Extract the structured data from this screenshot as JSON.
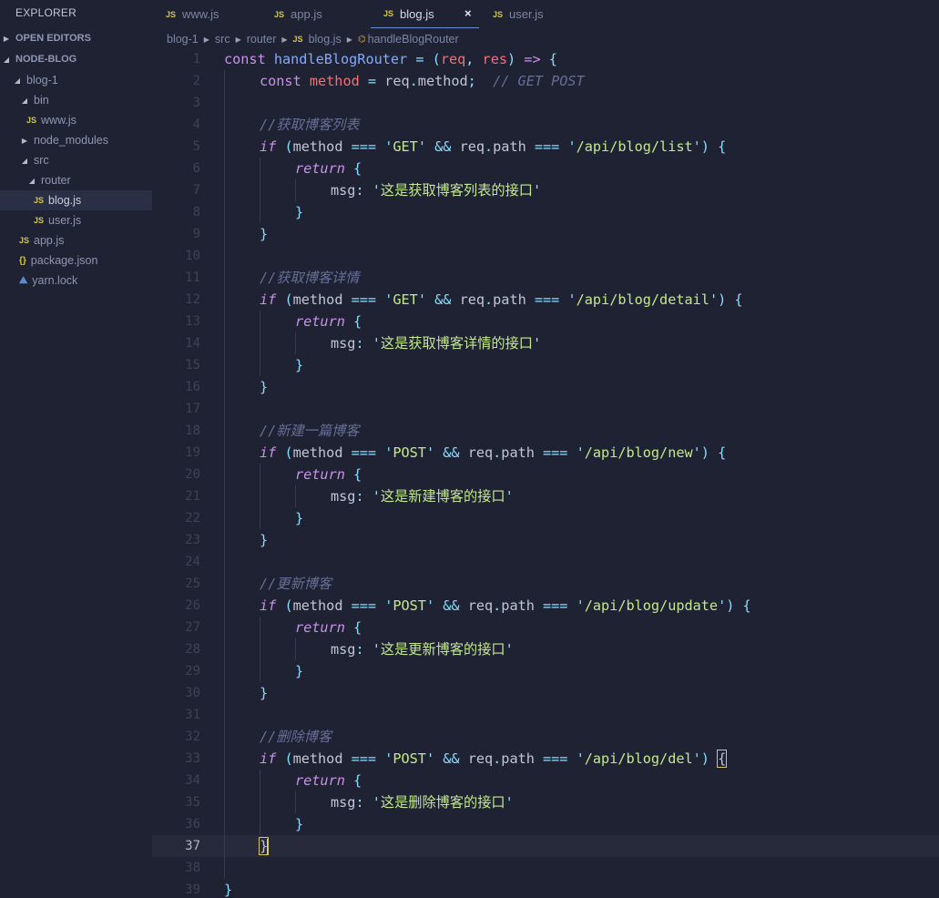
{
  "sidebar": {
    "title": "EXPLORER",
    "sections": [
      {
        "label": "OPEN EDITORS"
      },
      {
        "label": "NODE-BLOG"
      }
    ],
    "tree": [
      {
        "label": "blog-1",
        "type": "folder-open"
      },
      {
        "label": "bin",
        "type": "folder-open"
      },
      {
        "label": "www.js",
        "type": "js"
      },
      {
        "label": "node_modules",
        "type": "folder-closed"
      },
      {
        "label": "src",
        "type": "folder-open"
      },
      {
        "label": "router",
        "type": "folder-open"
      },
      {
        "label": "blog.js",
        "type": "js",
        "active": true
      },
      {
        "label": "user.js",
        "type": "js"
      },
      {
        "label": "app.js",
        "type": "js"
      },
      {
        "label": "package.json",
        "type": "json"
      },
      {
        "label": "yarn.lock",
        "type": "yarn"
      }
    ]
  },
  "tabs": [
    {
      "label": "www.js",
      "icon": "JS"
    },
    {
      "label": "app.js",
      "icon": "JS"
    },
    {
      "label": "blog.js",
      "icon": "JS",
      "active": true,
      "close": "×"
    },
    {
      "label": "user.js",
      "icon": "JS"
    }
  ],
  "breadcrumb": {
    "items": [
      "blog-1",
      "src",
      "router",
      "blog.js",
      "handleBlogRouter"
    ],
    "js_icon": "JS"
  },
  "editor": {
    "current_line": 37,
    "lines": [
      {
        "n": 1,
        "indent": 0,
        "tokens": [
          [
            "kw",
            "const"
          ],
          [
            "pl",
            " "
          ],
          [
            "fn",
            "handleBlogRouter"
          ],
          [
            "pl",
            " "
          ],
          [
            "op",
            "="
          ],
          [
            "pl",
            " "
          ],
          [
            "op",
            "("
          ],
          [
            "prm",
            "req"
          ],
          [
            "op",
            ", "
          ],
          [
            "prm",
            "res"
          ],
          [
            "op",
            ")"
          ],
          [
            "pl",
            " "
          ],
          [
            "kw",
            "=>"
          ],
          [
            "pl",
            " "
          ],
          [
            "op",
            "{"
          ]
        ]
      },
      {
        "n": 2,
        "indent": 1,
        "tokens": [
          [
            "kw",
            "const"
          ],
          [
            "pl",
            " "
          ],
          [
            "var",
            "method"
          ],
          [
            "pl",
            " "
          ],
          [
            "op",
            "="
          ],
          [
            "pl",
            " req"
          ],
          [
            "op",
            "."
          ],
          [
            "pl",
            "method"
          ],
          [
            "op",
            ";"
          ],
          [
            "pl",
            "  "
          ],
          [
            "cm",
            "// GET POST"
          ]
        ]
      },
      {
        "n": 3,
        "indent": 1,
        "tokens": []
      },
      {
        "n": 4,
        "indent": 1,
        "tokens": [
          [
            "cm",
            "//获取博客列表"
          ]
        ]
      },
      {
        "n": 5,
        "indent": 1,
        "tokens": [
          [
            "kwi",
            "if"
          ],
          [
            "pl",
            " "
          ],
          [
            "op",
            "("
          ],
          [
            "pl",
            "method "
          ],
          [
            "op",
            "==="
          ],
          [
            "pl",
            " "
          ],
          [
            "op",
            "'"
          ],
          [
            "str",
            "GET"
          ],
          [
            "op",
            "'"
          ],
          [
            "pl",
            " "
          ],
          [
            "op",
            "&&"
          ],
          [
            "pl",
            " req"
          ],
          [
            "op",
            "."
          ],
          [
            "pl",
            "path "
          ],
          [
            "op",
            "==="
          ],
          [
            "pl",
            " "
          ],
          [
            "op",
            "'"
          ],
          [
            "str",
            "/api/blog/list"
          ],
          [
            "op",
            "'"
          ],
          [
            "op",
            ")"
          ],
          [
            "pl",
            " "
          ],
          [
            "op",
            "{"
          ]
        ]
      },
      {
        "n": 6,
        "indent": 2,
        "tokens": [
          [
            "kwi",
            "return"
          ],
          [
            "pl",
            " "
          ],
          [
            "op",
            "{"
          ]
        ]
      },
      {
        "n": 7,
        "indent": 3,
        "tokens": [
          [
            "pl",
            "msg"
          ],
          [
            "op",
            ":"
          ],
          [
            "pl",
            " "
          ],
          [
            "op",
            "'"
          ],
          [
            "str",
            "这是获取博客列表的接口"
          ],
          [
            "op",
            "'"
          ]
        ]
      },
      {
        "n": 8,
        "indent": 2,
        "tokens": [
          [
            "op",
            "}"
          ]
        ]
      },
      {
        "n": 9,
        "indent": 1,
        "tokens": [
          [
            "op",
            "}"
          ]
        ]
      },
      {
        "n": 10,
        "indent": 1,
        "tokens": []
      },
      {
        "n": 11,
        "indent": 1,
        "tokens": [
          [
            "cm",
            "//获取博客详情"
          ]
        ]
      },
      {
        "n": 12,
        "indent": 1,
        "tokens": [
          [
            "kwi",
            "if"
          ],
          [
            "pl",
            " "
          ],
          [
            "op",
            "("
          ],
          [
            "pl",
            "method "
          ],
          [
            "op",
            "==="
          ],
          [
            "pl",
            " "
          ],
          [
            "op",
            "'"
          ],
          [
            "str",
            "GET"
          ],
          [
            "op",
            "'"
          ],
          [
            "pl",
            " "
          ],
          [
            "op",
            "&&"
          ],
          [
            "pl",
            " req"
          ],
          [
            "op",
            "."
          ],
          [
            "pl",
            "path "
          ],
          [
            "op",
            "==="
          ],
          [
            "pl",
            " "
          ],
          [
            "op",
            "'"
          ],
          [
            "str",
            "/api/blog/detail"
          ],
          [
            "op",
            "'"
          ],
          [
            "op",
            ")"
          ],
          [
            "pl",
            " "
          ],
          [
            "op",
            "{"
          ]
        ]
      },
      {
        "n": 13,
        "indent": 2,
        "tokens": [
          [
            "kwi",
            "return"
          ],
          [
            "pl",
            " "
          ],
          [
            "op",
            "{"
          ]
        ]
      },
      {
        "n": 14,
        "indent": 3,
        "tokens": [
          [
            "pl",
            "msg"
          ],
          [
            "op",
            ":"
          ],
          [
            "pl",
            " "
          ],
          [
            "op",
            "'"
          ],
          [
            "str",
            "这是获取博客详情的接口"
          ],
          [
            "op",
            "'"
          ]
        ]
      },
      {
        "n": 15,
        "indent": 2,
        "tokens": [
          [
            "op",
            "}"
          ]
        ]
      },
      {
        "n": 16,
        "indent": 1,
        "tokens": [
          [
            "op",
            "}"
          ]
        ]
      },
      {
        "n": 17,
        "indent": 1,
        "tokens": []
      },
      {
        "n": 18,
        "indent": 1,
        "tokens": [
          [
            "cm",
            "//新建一篇博客"
          ]
        ]
      },
      {
        "n": 19,
        "indent": 1,
        "tokens": [
          [
            "kwi",
            "if"
          ],
          [
            "pl",
            " "
          ],
          [
            "op",
            "("
          ],
          [
            "pl",
            "method "
          ],
          [
            "op",
            "==="
          ],
          [
            "pl",
            " "
          ],
          [
            "op",
            "'"
          ],
          [
            "str",
            "POST"
          ],
          [
            "op",
            "'"
          ],
          [
            "pl",
            " "
          ],
          [
            "op",
            "&&"
          ],
          [
            "pl",
            " req"
          ],
          [
            "op",
            "."
          ],
          [
            "pl",
            "path "
          ],
          [
            "op",
            "==="
          ],
          [
            "pl",
            " "
          ],
          [
            "op",
            "'"
          ],
          [
            "str",
            "/api/blog/new"
          ],
          [
            "op",
            "'"
          ],
          [
            "op",
            ")"
          ],
          [
            "pl",
            " "
          ],
          [
            "op",
            "{"
          ]
        ]
      },
      {
        "n": 20,
        "indent": 2,
        "tokens": [
          [
            "kwi",
            "return"
          ],
          [
            "pl",
            " "
          ],
          [
            "op",
            "{"
          ]
        ]
      },
      {
        "n": 21,
        "indent": 3,
        "tokens": [
          [
            "pl",
            "msg"
          ],
          [
            "op",
            ":"
          ],
          [
            "pl",
            " "
          ],
          [
            "op",
            "'"
          ],
          [
            "str",
            "这是新建博客的接口"
          ],
          [
            "op",
            "'"
          ]
        ]
      },
      {
        "n": 22,
        "indent": 2,
        "tokens": [
          [
            "op",
            "}"
          ]
        ]
      },
      {
        "n": 23,
        "indent": 1,
        "tokens": [
          [
            "op",
            "}"
          ]
        ]
      },
      {
        "n": 24,
        "indent": 1,
        "tokens": []
      },
      {
        "n": 25,
        "indent": 1,
        "tokens": [
          [
            "cm",
            "//更新博客"
          ]
        ]
      },
      {
        "n": 26,
        "indent": 1,
        "tokens": [
          [
            "kwi",
            "if"
          ],
          [
            "pl",
            " "
          ],
          [
            "op",
            "("
          ],
          [
            "pl",
            "method "
          ],
          [
            "op",
            "==="
          ],
          [
            "pl",
            " "
          ],
          [
            "op",
            "'"
          ],
          [
            "str",
            "POST"
          ],
          [
            "op",
            "'"
          ],
          [
            "pl",
            " "
          ],
          [
            "op",
            "&&"
          ],
          [
            "pl",
            " req"
          ],
          [
            "op",
            "."
          ],
          [
            "pl",
            "path "
          ],
          [
            "op",
            "==="
          ],
          [
            "pl",
            " "
          ],
          [
            "op",
            "'"
          ],
          [
            "str",
            "/api/blog/update"
          ],
          [
            "op",
            "'"
          ],
          [
            "op",
            ")"
          ],
          [
            "pl",
            " "
          ],
          [
            "op",
            "{"
          ]
        ]
      },
      {
        "n": 27,
        "indent": 2,
        "tokens": [
          [
            "kwi",
            "return"
          ],
          [
            "pl",
            " "
          ],
          [
            "op",
            "{"
          ]
        ]
      },
      {
        "n": 28,
        "indent": 3,
        "tokens": [
          [
            "pl",
            "msg"
          ],
          [
            "op",
            ":"
          ],
          [
            "pl",
            " "
          ],
          [
            "op",
            "'"
          ],
          [
            "str",
            "这是更新博客的接口"
          ],
          [
            "op",
            "'"
          ]
        ]
      },
      {
        "n": 29,
        "indent": 2,
        "tokens": [
          [
            "op",
            "}"
          ]
        ]
      },
      {
        "n": 30,
        "indent": 1,
        "tokens": [
          [
            "op",
            "}"
          ]
        ]
      },
      {
        "n": 31,
        "indent": 1,
        "tokens": []
      },
      {
        "n": 32,
        "indent": 1,
        "tokens": [
          [
            "cm",
            "//删除博客"
          ]
        ]
      },
      {
        "n": 33,
        "indent": 1,
        "tokens": [
          [
            "kwi",
            "if"
          ],
          [
            "pl",
            " "
          ],
          [
            "op",
            "("
          ],
          [
            "pl",
            "method "
          ],
          [
            "op",
            "==="
          ],
          [
            "pl",
            " "
          ],
          [
            "op",
            "'"
          ],
          [
            "str",
            "POST"
          ],
          [
            "op",
            "'"
          ],
          [
            "pl",
            " "
          ],
          [
            "op",
            "&&"
          ],
          [
            "pl",
            " req"
          ],
          [
            "op",
            "."
          ],
          [
            "pl",
            "path "
          ],
          [
            "op",
            "==="
          ],
          [
            "pl",
            " "
          ],
          [
            "op",
            "'"
          ],
          [
            "str",
            "/api/blog/del"
          ],
          [
            "op",
            "'"
          ],
          [
            "op",
            ")"
          ],
          [
            "pl",
            " "
          ],
          [
            "brm",
            "{"
          ]
        ]
      },
      {
        "n": 34,
        "indent": 2,
        "tokens": [
          [
            "kwi",
            "return"
          ],
          [
            "pl",
            " "
          ],
          [
            "op",
            "{"
          ]
        ]
      },
      {
        "n": 35,
        "indent": 3,
        "tokens": [
          [
            "pl",
            "msg"
          ],
          [
            "op",
            ":"
          ],
          [
            "pl",
            " "
          ],
          [
            "op",
            "'"
          ],
          [
            "str",
            "这是删除博客的接口"
          ],
          [
            "op",
            "'"
          ]
        ]
      },
      {
        "n": 36,
        "indent": 2,
        "tokens": [
          [
            "op",
            "}"
          ]
        ]
      },
      {
        "n": 37,
        "indent": 1,
        "tokens": [
          [
            "brm",
            "}"
          ]
        ],
        "cursor": true
      },
      {
        "n": 38,
        "indent": 1,
        "tokens": []
      },
      {
        "n": 39,
        "indent": 0,
        "tokens": [
          [
            "op",
            "}"
          ]
        ]
      }
    ]
  }
}
